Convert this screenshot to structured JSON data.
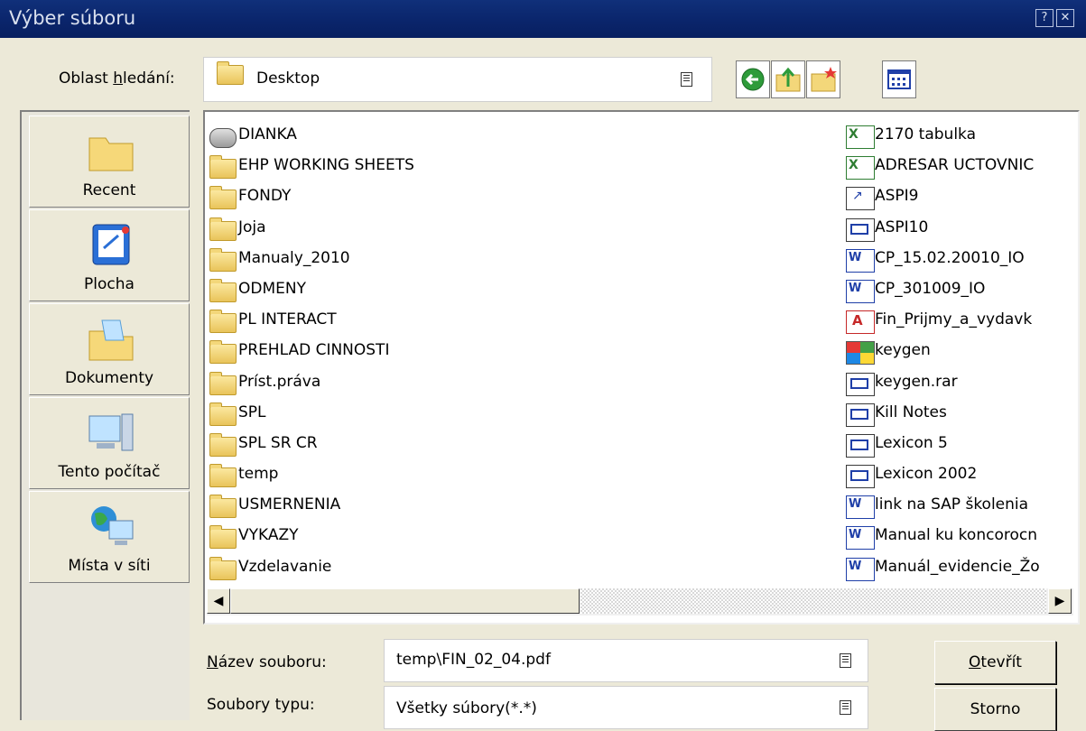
{
  "window": {
    "title": "Výber súboru",
    "help_glyph": "?",
    "close_glyph": "✕"
  },
  "lookin": {
    "label_pre": "Oblast ",
    "label_u": "h",
    "label_post": "ledání:",
    "value": "Desktop"
  },
  "toolbar": {
    "back_icon": "back-arrow-icon",
    "up_icon": "up-folder-icon",
    "new_folder_icon": "new-folder-icon",
    "view_icon": "view-menu-icon"
  },
  "places": [
    {
      "label": "Recent",
      "icon": "recent-folder-icon"
    },
    {
      "label": "Plocha",
      "icon": "desktop-icon"
    },
    {
      "label": "Dokumenty",
      "icon": "documents-folder-icon"
    },
    {
      "label": "Tento počítač",
      "icon": "computer-icon"
    },
    {
      "label": "Místa v síti",
      "icon": "network-icon"
    }
  ],
  "files_left": [
    {
      "name": "DIANKA",
      "type": "drive"
    },
    {
      "name": "EHP WORKING SHEETS",
      "type": "folder"
    },
    {
      "name": "FONDY",
      "type": "folder"
    },
    {
      "name": "Joja",
      "type": "folder"
    },
    {
      "name": "Manualy_2010",
      "type": "folder"
    },
    {
      "name": "ODMENY",
      "type": "folder"
    },
    {
      "name": "PL INTERACT",
      "type": "folder"
    },
    {
      "name": "PREHLAD CINNOSTI",
      "type": "folder"
    },
    {
      "name": "Príst.práva",
      "type": "folder"
    },
    {
      "name": "SPL",
      "type": "folder"
    },
    {
      "name": "SPL SR CR",
      "type": "folder"
    },
    {
      "name": "temp",
      "type": "folder"
    },
    {
      "name": "USMERNENIA",
      "type": "folder"
    },
    {
      "name": "VYKAZY",
      "type": "folder"
    },
    {
      "name": "Vzdelavanie",
      "type": "folder"
    }
  ],
  "files_right": [
    {
      "name": "2170 tabulka",
      "type": "xls"
    },
    {
      "name": "ADRESAR UCTOVNIC",
      "type": "xls"
    },
    {
      "name": "ASPI9",
      "type": "lnk"
    },
    {
      "name": "ASPI10",
      "type": "exe"
    },
    {
      "name": "CP_15.02.20010_IO",
      "type": "doc"
    },
    {
      "name": "CP_301009_IO",
      "type": "doc"
    },
    {
      "name": "Fin_Prijmy_a_vydavk",
      "type": "pdf"
    },
    {
      "name": "keygen",
      "type": "win"
    },
    {
      "name": "keygen.rar",
      "type": "exe"
    },
    {
      "name": "Kill Notes",
      "type": "exe"
    },
    {
      "name": "Lexicon 5",
      "type": "exe"
    },
    {
      "name": "Lexicon 2002",
      "type": "exe"
    },
    {
      "name": "link na SAP školenia",
      "type": "doc"
    },
    {
      "name": "Manual ku koncorocn",
      "type": "doc"
    },
    {
      "name": "Manuál_evidencie_Žo",
      "type": "doc"
    }
  ],
  "scroll": {
    "left_glyph": "◀",
    "right_glyph": "▶"
  },
  "filename": {
    "label_u": "N",
    "label_rest": "ázev souboru:",
    "value": "temp\\FIN_02_04.pdf"
  },
  "filetype": {
    "label": "Soubory typu:",
    "value": "Všetky súbory(*.*)"
  },
  "buttons": {
    "open_u": "O",
    "open_rest": "tevřít",
    "cancel": "Storno"
  }
}
